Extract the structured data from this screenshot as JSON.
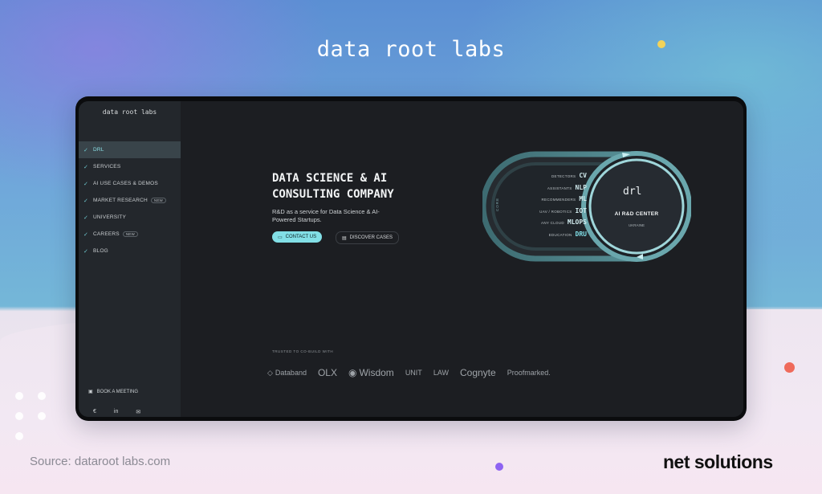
{
  "banner": {
    "title": "data root labs",
    "source": "Source: dataroot labs.com",
    "brand_logo": "net solutions"
  },
  "sidebar": {
    "logo": "data root labs",
    "items": [
      {
        "label": "DRL",
        "active": true
      },
      {
        "label": "SERVICES"
      },
      {
        "label": "AI USE CASES & DEMOS"
      },
      {
        "label": "MARKET RESEARCH",
        "badge": "NEW"
      },
      {
        "label": "UNIVERSITY"
      },
      {
        "label": "CAREERS",
        "badge": "NEW"
      },
      {
        "label": "BLOG"
      }
    ],
    "book_meeting": "BOOK A MEETING",
    "socials": [
      "€",
      "in",
      "✉"
    ]
  },
  "hero": {
    "headline_line1": "DATA SCIENCE & AI",
    "headline_line2": "CONSULTING COMPANY",
    "subline": "R&D as a service for Data Science & AI-Powered Startups.",
    "contact_label": "CONTACT US",
    "discover_label": "DISCOVER CASES"
  },
  "diagram": {
    "core_label": "CORE",
    "tags": [
      {
        "small": "DETECTORS",
        "big": "CV"
      },
      {
        "small": "ASSISTANTS",
        "big": "NLP"
      },
      {
        "small": "RECOMMENDERS",
        "big": "ML"
      },
      {
        "small": "UAV / ROBOTICS",
        "big": "IOT"
      },
      {
        "small": "ANY CLOUD",
        "big": "MLOPS"
      },
      {
        "small": "EDUCATION",
        "big": "DRU",
        "highlight": true
      }
    ],
    "center_mark": "drl",
    "center_title": "AI R&D CENTER",
    "center_sub": "UKRAINE"
  },
  "partners": {
    "label": "TRUSTED TO CO-BUILD WITH",
    "logos": [
      "Databand",
      "OLX",
      "Wisdom",
      "UNIT",
      "LAW",
      "Cognyte",
      "Proofmarked."
    ]
  },
  "colors": {
    "accent": "#82dfe6",
    "screen_bg": "#1c1e22",
    "sidebar_bg": "#23272c"
  }
}
